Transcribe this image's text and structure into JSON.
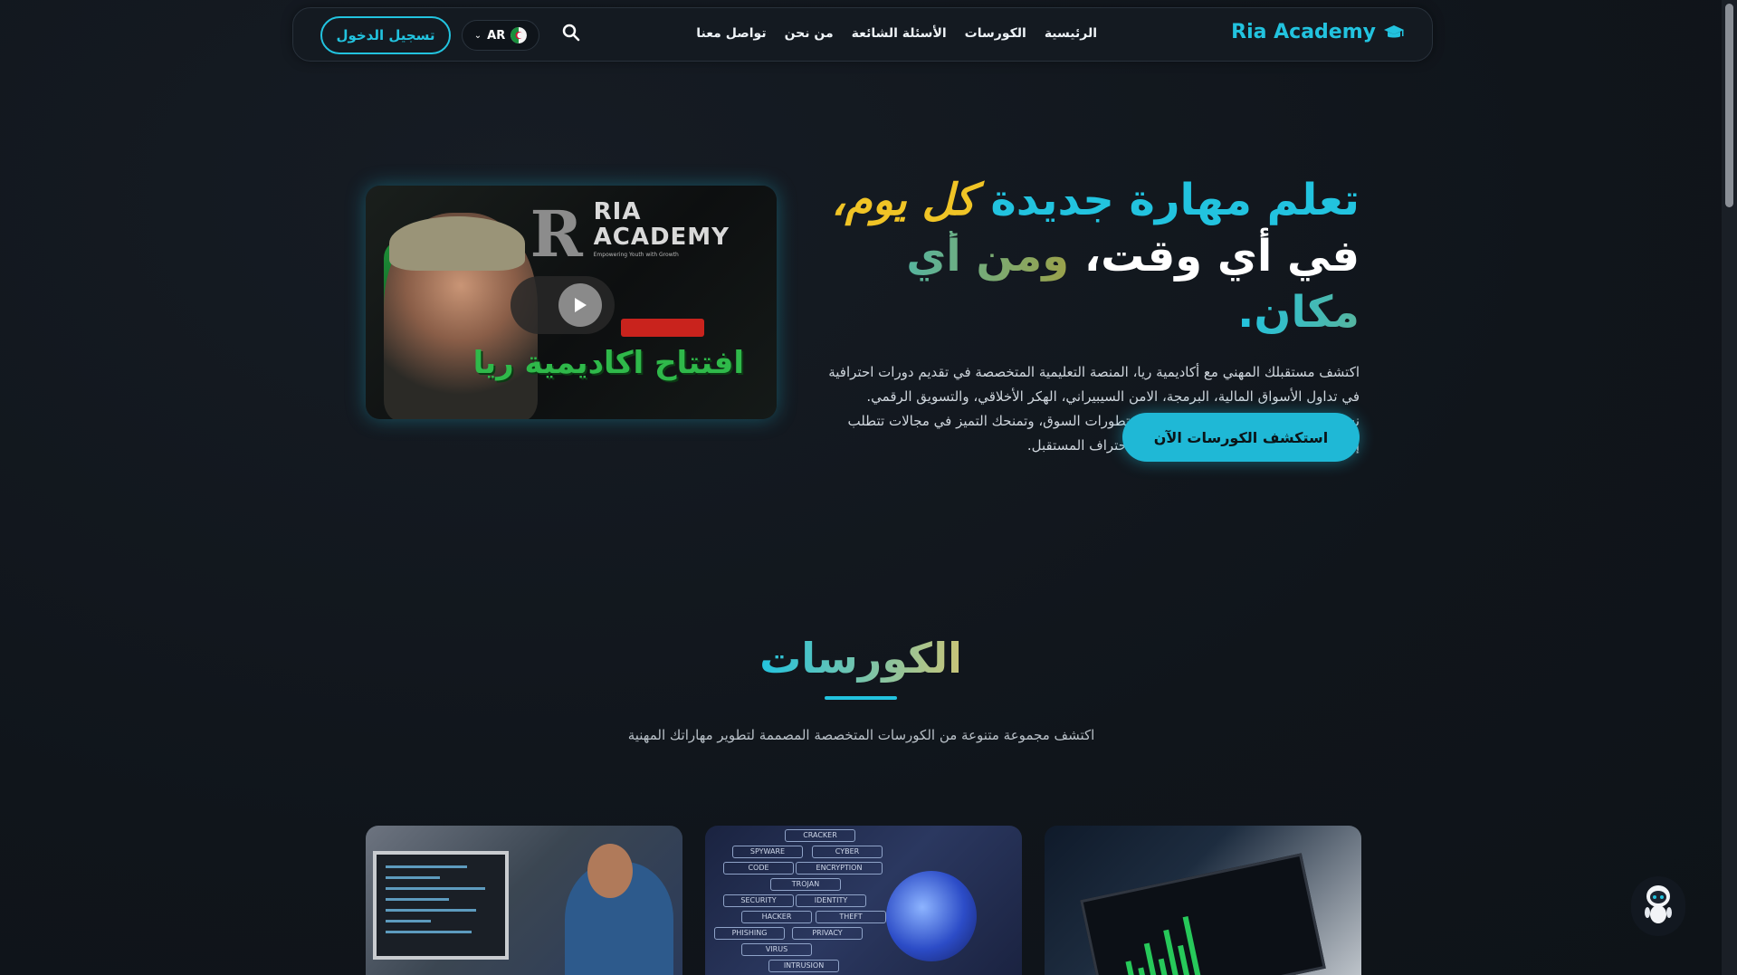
{
  "header": {
    "brand": "Ria Academy",
    "nav": [
      "الرئيسية",
      "الكورسات",
      "الأسئلة الشائعة",
      "من نحن",
      "تواصل معنا"
    ],
    "language": "AR",
    "login_label": "تسجيل الدخول"
  },
  "hero": {
    "headline": {
      "line1_part1": "تعلم مهارة جديدة",
      "line1_part2": "كل يوم،",
      "line2_part1": "في أي وقت،",
      "line2_part2": "ومن أي مكان."
    },
    "description": "اكتشف مستقبلك المهني مع أكاديمية ريا، المنصة التعليمية المتخصصة في تقديم دورات احترافية في تداول الأسواق المالية، البرمجة، الامن السيبيراني، الهكر الأخلاقي، والتسويق الرقمي. نساعدك على بناء مهارات متقدمة تواكب تطورات السوق، وتمنحك التميز في مجالات تتطلب إبداعًا وخبرة تقنية عالية. انطلق معنا نحو احتراف المستقبل.",
    "cta_label": "استكشف الكورسات الآن",
    "video": {
      "logo_text_1": "RIA",
      "logo_text_2": "ACADEMY",
      "logo_tagline": "Empowering Youth with Growth",
      "logo_mark": "R",
      "title": "افتتاح اكاديمية ريا"
    }
  },
  "courses": {
    "title": "الكورسات",
    "subtitle": "اكتشف مجموعة متنوعة من الكورسات المتخصصة المصممة لتطوير مهاراتك المهنية",
    "card2_tags": [
      "CRACKER",
      "SPYWARE",
      "CYBER",
      "CODE",
      "ENCRYPTION",
      "TROJAN",
      "SECURITY",
      "IDENTITY",
      "HACKER",
      "THEFT",
      "PHISHING",
      "PRIVACY",
      "VIRUS",
      "INTRUSION"
    ]
  },
  "colors": {
    "accent": "#22c3df",
    "highlight": "#f0c426",
    "background": "#11161d"
  },
  "icons": {
    "brand": "graduation-cap-icon",
    "search": "search-icon",
    "flag": "algeria-flag-icon",
    "chevron": "chevron-down-icon",
    "play": "play-icon",
    "chatbot": "robot-icon"
  }
}
